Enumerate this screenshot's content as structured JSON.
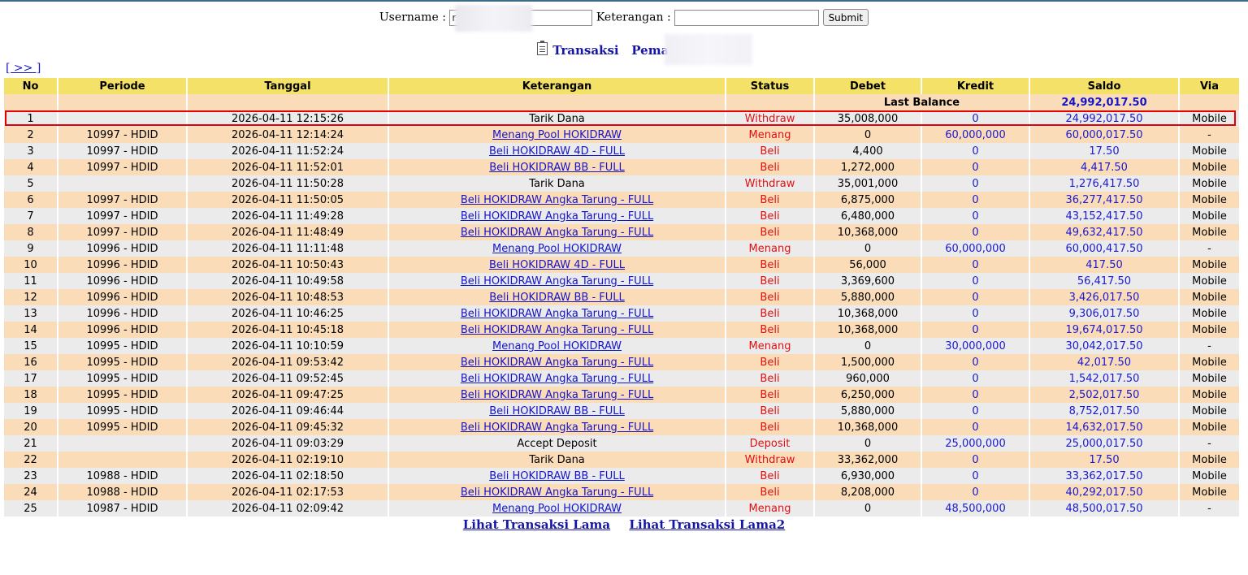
{
  "search": {
    "username_label": "Username :",
    "username_value": "r",
    "keterangan_label": "Keterangan :",
    "keterangan_value": "",
    "submit_label": "Submit"
  },
  "heading": {
    "transaksi": "Transaksi",
    "pemain": "Pemain : ru"
  },
  "nav": {
    "next_label": "[ >> ]"
  },
  "table": {
    "headers": [
      "No",
      "Periode",
      "Tanggal",
      "Keterangan",
      "Status",
      "Debet",
      "Kredit",
      "Saldo",
      "Via"
    ],
    "last_balance_label": "Last Balance",
    "last_balance_value": "24,992,017.50",
    "rows": [
      {
        "no": "1",
        "periode": "",
        "tanggal": "2026-04-11 12:15:26",
        "ket": "Tarik Dana",
        "link": false,
        "status": "Withdraw",
        "debet": "35,008,000",
        "kredit": "0",
        "saldo": "24,992,017.50",
        "via": "Mobile"
      },
      {
        "no": "2",
        "periode": "10997 - HDID",
        "tanggal": "2026-04-11 12:14:24",
        "ket": "Menang Pool HOKIDRAW",
        "link": true,
        "status": "Menang",
        "debet": "0",
        "kredit": "60,000,000",
        "saldo": "60,000,017.50",
        "via": "-"
      },
      {
        "no": "3",
        "periode": "10997 - HDID",
        "tanggal": "2026-04-11 11:52:24",
        "ket": "Beli HOKIDRAW 4D - FULL",
        "link": true,
        "status": "Beli",
        "debet": "4,400",
        "kredit": "0",
        "saldo": "17.50",
        "via": "Mobile"
      },
      {
        "no": "4",
        "periode": "10997 - HDID",
        "tanggal": "2026-04-11 11:52:01",
        "ket": "Beli HOKIDRAW BB - FULL",
        "link": true,
        "status": "Beli",
        "debet": "1,272,000",
        "kredit": "0",
        "saldo": "4,417.50",
        "via": "Mobile"
      },
      {
        "no": "5",
        "periode": "",
        "tanggal": "2026-04-11 11:50:28",
        "ket": "Tarik Dana",
        "link": false,
        "status": "Withdraw",
        "debet": "35,001,000",
        "kredit": "0",
        "saldo": "1,276,417.50",
        "via": "Mobile"
      },
      {
        "no": "6",
        "periode": "10997 - HDID",
        "tanggal": "2026-04-11 11:50:05",
        "ket": "Beli HOKIDRAW Angka Tarung - FULL",
        "link": true,
        "status": "Beli",
        "debet": "6,875,000",
        "kredit": "0",
        "saldo": "36,277,417.50",
        "via": "Mobile"
      },
      {
        "no": "7",
        "periode": "10997 - HDID",
        "tanggal": "2026-04-11 11:49:28",
        "ket": "Beli HOKIDRAW Angka Tarung - FULL",
        "link": true,
        "status": "Beli",
        "debet": "6,480,000",
        "kredit": "0",
        "saldo": "43,152,417.50",
        "via": "Mobile"
      },
      {
        "no": "8",
        "periode": "10997 - HDID",
        "tanggal": "2026-04-11 11:48:49",
        "ket": "Beli HOKIDRAW Angka Tarung - FULL",
        "link": true,
        "status": "Beli",
        "debet": "10,368,000",
        "kredit": "0",
        "saldo": "49,632,417.50",
        "via": "Mobile"
      },
      {
        "no": "9",
        "periode": "10996 - HDID",
        "tanggal": "2026-04-11 11:11:48",
        "ket": "Menang Pool HOKIDRAW",
        "link": true,
        "status": "Menang",
        "debet": "0",
        "kredit": "60,000,000",
        "saldo": "60,000,417.50",
        "via": "-"
      },
      {
        "no": "10",
        "periode": "10996 - HDID",
        "tanggal": "2026-04-11 10:50:43",
        "ket": "Beli HOKIDRAW 4D - FULL",
        "link": true,
        "status": "Beli",
        "debet": "56,000",
        "kredit": "0",
        "saldo": "417.50",
        "via": "Mobile"
      },
      {
        "no": "11",
        "periode": "10996 - HDID",
        "tanggal": "2026-04-11 10:49:58",
        "ket": "Beli HOKIDRAW Angka Tarung - FULL",
        "link": true,
        "status": "Beli",
        "debet": "3,369,600",
        "kredit": "0",
        "saldo": "56,417.50",
        "via": "Mobile"
      },
      {
        "no": "12",
        "periode": "10996 - HDID",
        "tanggal": "2026-04-11 10:48:53",
        "ket": "Beli HOKIDRAW BB - FULL",
        "link": true,
        "status": "Beli",
        "debet": "5,880,000",
        "kredit": "0",
        "saldo": "3,426,017.50",
        "via": "Mobile"
      },
      {
        "no": "13",
        "periode": "10996 - HDID",
        "tanggal": "2026-04-11 10:46:25",
        "ket": "Beli HOKIDRAW Angka Tarung - FULL",
        "link": true,
        "status": "Beli",
        "debet": "10,368,000",
        "kredit": "0",
        "saldo": "9,306,017.50",
        "via": "Mobile"
      },
      {
        "no": "14",
        "periode": "10996 - HDID",
        "tanggal": "2026-04-11 10:45:18",
        "ket": "Beli HOKIDRAW Angka Tarung - FULL",
        "link": true,
        "status": "Beli",
        "debet": "10,368,000",
        "kredit": "0",
        "saldo": "19,674,017.50",
        "via": "Mobile"
      },
      {
        "no": "15",
        "periode": "10995 - HDID",
        "tanggal": "2026-04-11 10:10:59",
        "ket": "Menang Pool HOKIDRAW",
        "link": true,
        "status": "Menang",
        "debet": "0",
        "kredit": "30,000,000",
        "saldo": "30,042,017.50",
        "via": "-"
      },
      {
        "no": "16",
        "periode": "10995 - HDID",
        "tanggal": "2026-04-11 09:53:42",
        "ket": "Beli HOKIDRAW Angka Tarung - FULL",
        "link": true,
        "status": "Beli",
        "debet": "1,500,000",
        "kredit": "0",
        "saldo": "42,017.50",
        "via": "Mobile"
      },
      {
        "no": "17",
        "periode": "10995 - HDID",
        "tanggal": "2026-04-11 09:52:45",
        "ket": "Beli HOKIDRAW Angka Tarung - FULL",
        "link": true,
        "status": "Beli",
        "debet": "960,000",
        "kredit": "0",
        "saldo": "1,542,017.50",
        "via": "Mobile"
      },
      {
        "no": "18",
        "periode": "10995 - HDID",
        "tanggal": "2026-04-11 09:47:25",
        "ket": "Beli HOKIDRAW Angka Tarung - FULL",
        "link": true,
        "status": "Beli",
        "debet": "6,250,000",
        "kredit": "0",
        "saldo": "2,502,017.50",
        "via": "Mobile"
      },
      {
        "no": "19",
        "periode": "10995 - HDID",
        "tanggal": "2026-04-11 09:46:44",
        "ket": "Beli HOKIDRAW BB - FULL",
        "link": true,
        "status": "Beli",
        "debet": "5,880,000",
        "kredit": "0",
        "saldo": "8,752,017.50",
        "via": "Mobile"
      },
      {
        "no": "20",
        "periode": "10995 - HDID",
        "tanggal": "2026-04-11 09:45:32",
        "ket": "Beli HOKIDRAW Angka Tarung - FULL",
        "link": true,
        "status": "Beli",
        "debet": "10,368,000",
        "kredit": "0",
        "saldo": "14,632,017.50",
        "via": "Mobile"
      },
      {
        "no": "21",
        "periode": "",
        "tanggal": "2026-04-11 09:03:29",
        "ket": "Accept Deposit",
        "link": false,
        "status": "Deposit",
        "debet": "0",
        "kredit": "25,000,000",
        "saldo": "25,000,017.50",
        "via": "-"
      },
      {
        "no": "22",
        "periode": "",
        "tanggal": "2026-04-11 02:19:10",
        "ket": "Tarik Dana",
        "link": false,
        "status": "Withdraw",
        "debet": "33,362,000",
        "kredit": "0",
        "saldo": "17.50",
        "via": "Mobile"
      },
      {
        "no": "23",
        "periode": "10988 - HDID",
        "tanggal": "2026-04-11 02:18:50",
        "ket": "Beli HOKIDRAW BB - FULL",
        "link": true,
        "status": "Beli",
        "debet": "6,930,000",
        "kredit": "0",
        "saldo": "33,362,017.50",
        "via": "Mobile"
      },
      {
        "no": "24",
        "periode": "10988 - HDID",
        "tanggal": "2026-04-11 02:17:53",
        "ket": "Beli HOKIDRAW Angka Tarung - FULL",
        "link": true,
        "status": "Beli",
        "debet": "8,208,000",
        "kredit": "0",
        "saldo": "40,292,017.50",
        "via": "Mobile"
      },
      {
        "no": "25",
        "periode": "10987 - HDID",
        "tanggal": "2026-04-11 02:09:42",
        "ket": "Menang Pool HOKIDRAW",
        "link": true,
        "status": "Menang",
        "debet": "0",
        "kredit": "48,500,000",
        "saldo": "48,500,017.50",
        "via": "-"
      }
    ]
  },
  "footer": {
    "link1": "Lihat Transaksi Lama",
    "link2": "Lihat Transaksi Lama2"
  },
  "colors": {
    "header_bg": "#f4e268",
    "row_even": "#fbdcb8",
    "row_odd": "#ebebeb",
    "status_red": "#e01010",
    "link_blue": "#1515c8",
    "highlight_border": "#e60000"
  },
  "icons": {
    "doc": "document-icon"
  }
}
